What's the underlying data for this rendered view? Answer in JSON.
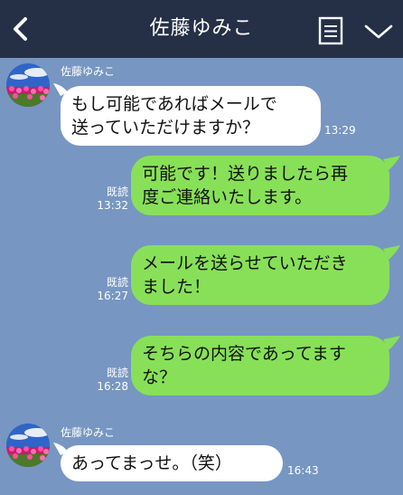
{
  "header": {
    "title": "佐藤ゆみこ",
    "back_icon": "chevron-left-icon",
    "menu_icon": "notes-icon",
    "chevron_icon": "chevron-down-icon"
  },
  "messages": [
    {
      "direction": "incoming",
      "sender": "佐藤ゆみこ",
      "lines": [
        "もし可能であればメールで",
        "送っていただけますか？"
      ],
      "time": "13:29"
    },
    {
      "direction": "outgoing",
      "lines": [
        "可能です！送りましたら再",
        "度ご連絡いたします。"
      ],
      "read": "既読",
      "time": "13:32"
    },
    {
      "direction": "outgoing",
      "lines": [
        "メールを送らせていただき",
        "ました！"
      ],
      "read": "既読",
      "time": "16:27"
    },
    {
      "direction": "outgoing",
      "lines": [
        "そちらの内容であってます",
        "な？"
      ],
      "read": "既読",
      "time": "16:28"
    },
    {
      "direction": "incoming",
      "sender": "佐藤ゆみこ",
      "lines": [
        "あってまっせ。（笑）"
      ],
      "time": "16:43"
    }
  ],
  "colors": {
    "header_bg": "#252f46",
    "chat_bg": "#7796c2",
    "incoming_bubble": "#ffffff",
    "outgoing_bubble": "#88e058"
  }
}
